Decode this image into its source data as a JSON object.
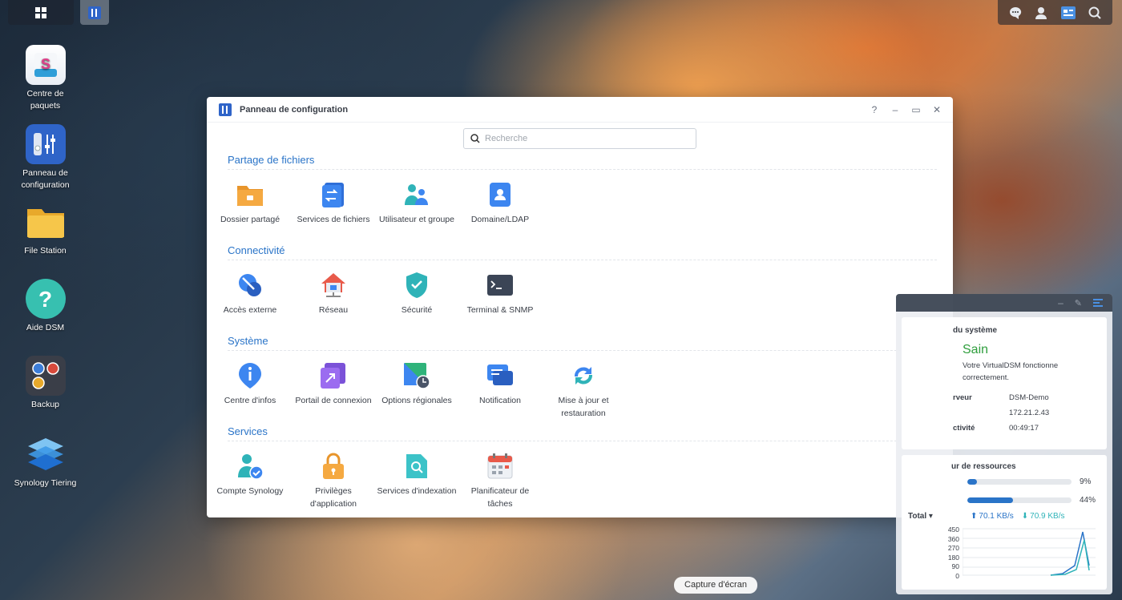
{
  "window": {
    "title": "Panneau de configuration",
    "search_placeholder": "Recherche",
    "controls": [
      "?",
      "–",
      "▭",
      "✕"
    ]
  },
  "sections": [
    {
      "title": "Partage de fichiers",
      "items": [
        {
          "label": "Dossier partagé",
          "icon": "folder-share-icon"
        },
        {
          "label": "Services de fichiers",
          "icon": "file-services-icon"
        },
        {
          "label": "Utilisateur et groupe",
          "icon": "user-group-icon"
        },
        {
          "label": "Domaine/LDAP",
          "icon": "domain-ldap-icon"
        }
      ]
    },
    {
      "title": "Connectivité",
      "items": [
        {
          "label": "Accès externe",
          "icon": "external-access-icon"
        },
        {
          "label": "Réseau",
          "icon": "network-icon"
        },
        {
          "label": "Sécurité",
          "icon": "security-shield-icon"
        },
        {
          "label": "Terminal & SNMP",
          "icon": "terminal-icon"
        }
      ]
    },
    {
      "title": "Système",
      "items": [
        {
          "label": "Centre d'infos",
          "icon": "info-center-icon"
        },
        {
          "label": "Portail de connexion",
          "icon": "login-portal-icon"
        },
        {
          "label": "Options régionales",
          "icon": "regional-options-icon"
        },
        {
          "label": "Notification",
          "icon": "notification-icon"
        },
        {
          "label": "Mise à jour et restauration",
          "icon": "update-restore-icon"
        }
      ]
    },
    {
      "title": "Services",
      "items": [
        {
          "label": "Compte Synology",
          "icon": "synology-account-icon"
        },
        {
          "label": "Privilèges d'application",
          "icon": "app-privileges-icon"
        },
        {
          "label": "Services d'indexation",
          "icon": "indexing-service-icon"
        },
        {
          "label": "Planificateur de tâches",
          "icon": "task-scheduler-icon"
        }
      ]
    }
  ],
  "desktop": [
    {
      "label": "Centre de paquets",
      "icon": "package-center-icon"
    },
    {
      "label": "Panneau de configuration",
      "icon": "control-panel-icon"
    },
    {
      "label": "File Station",
      "icon": "file-station-icon"
    },
    {
      "label": "Aide DSM",
      "icon": "help-icon"
    },
    {
      "label": "Backup",
      "icon": "backup-icon"
    },
    {
      "label": "Synology Tiering",
      "icon": "tiering-icon"
    }
  ],
  "widgets": {
    "system": {
      "title": "du système",
      "status": "Sain",
      "status_desc": "Votre VirtualDSM fonctionne correctement.",
      "server_label": "rveur",
      "server_value": "DSM-Demo",
      "ip_value": "172.21.2.43",
      "uptime_label": "ctivité",
      "uptime_value": "00:49:17"
    },
    "resources": {
      "title": "ur de ressources",
      "cpu_percent": "9%",
      "cpu_fill": 0.09,
      "ram_percent": "44%",
      "ram_fill": 0.44,
      "total_label": "Total ▾",
      "upload": "70.1 KB/s",
      "download": "70.9 KB/s",
      "y_ticks": [
        "450",
        "360",
        "270",
        "180",
        "90",
        "0"
      ]
    }
  },
  "tooltip": "Capture d'écran",
  "colors": {
    "accent": "#2a74c8",
    "status_ok": "#2e9e3c"
  }
}
